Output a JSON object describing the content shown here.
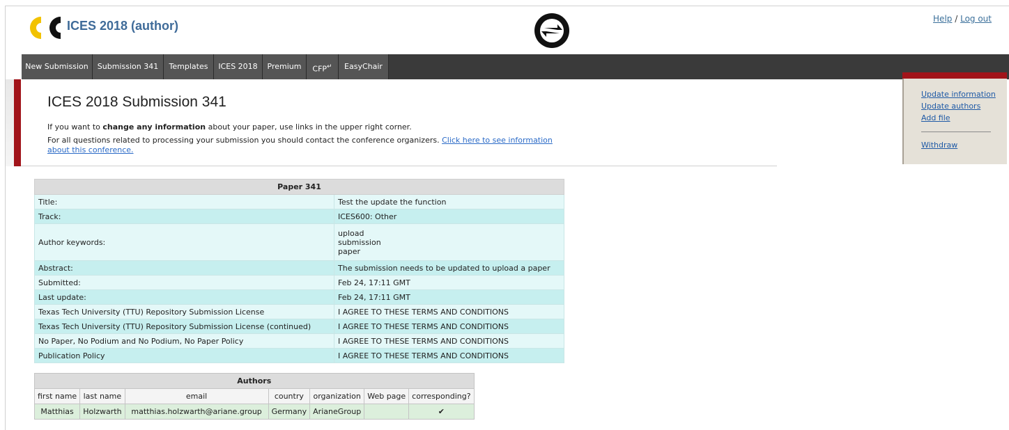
{
  "header": {
    "app_title": "ICES 2018 (author)",
    "help_label": "Help",
    "separator": "/",
    "logout_label": "Log out"
  },
  "nav": {
    "items": [
      "New Submission",
      "Submission 341",
      "Templates",
      "ICES 2018",
      "Premium",
      "CFP",
      "EasyChair"
    ]
  },
  "main": {
    "heading": "ICES 2018 Submission 341",
    "line1_pre": "If you want to ",
    "line1_bold": "change any information",
    "line1_post": " about your paper, use links in the upper right corner.",
    "line2_pre": "For all questions related to processing your submission you should contact the conference organizers. ",
    "line2_link_a": "Click here to see information",
    "line2_link_b": "about this conference."
  },
  "side_panel": {
    "update_information": "Update information",
    "update_authors": "Update authors",
    "add_file": "Add file",
    "withdraw": "Withdraw"
  },
  "paper_table": {
    "title": "Paper 341",
    "rows": [
      {
        "label": "Title:",
        "value": "Test the update the function"
      },
      {
        "label": "Track:",
        "value": "ICES600: Other"
      },
      {
        "label": "Author keywords:",
        "values": [
          "upload",
          "submission",
          "paper"
        ]
      },
      {
        "label": "Abstract:",
        "value": "The submission needs to be updated to upload a paper"
      },
      {
        "label": "Submitted:",
        "value": "Feb 24, 17:11 GMT"
      },
      {
        "label": "Last update:",
        "value": "Feb 24, 17:11 GMT"
      },
      {
        "label": "Texas Tech University (TTU) Repository Submission License",
        "value": "I AGREE TO THESE TERMS AND CONDITIONS"
      },
      {
        "label": "Texas Tech University (TTU) Repository Submission License (continued)",
        "value": "I AGREE TO THESE TERMS AND CONDITIONS"
      },
      {
        "label": "No Paper, No Podium and No Podium, No Paper Policy",
        "value": "I AGREE TO THESE TERMS AND CONDITIONS"
      },
      {
        "label": "Publication Policy",
        "value": "I AGREE TO THESE TERMS AND CONDITIONS"
      }
    ]
  },
  "authors_table": {
    "title": "Authors",
    "columns": [
      "first name",
      "last name",
      "email",
      "country",
      "organization",
      "Web page",
      "corresponding?"
    ],
    "rows": [
      {
        "first_name": "Matthias",
        "last_name": "Holzwarth",
        "email": "matthias.holzwarth@ariane.group",
        "country": "Germany",
        "organization": "ArianeGroup",
        "web_page": "",
        "corresponding": "✔"
      }
    ]
  }
}
